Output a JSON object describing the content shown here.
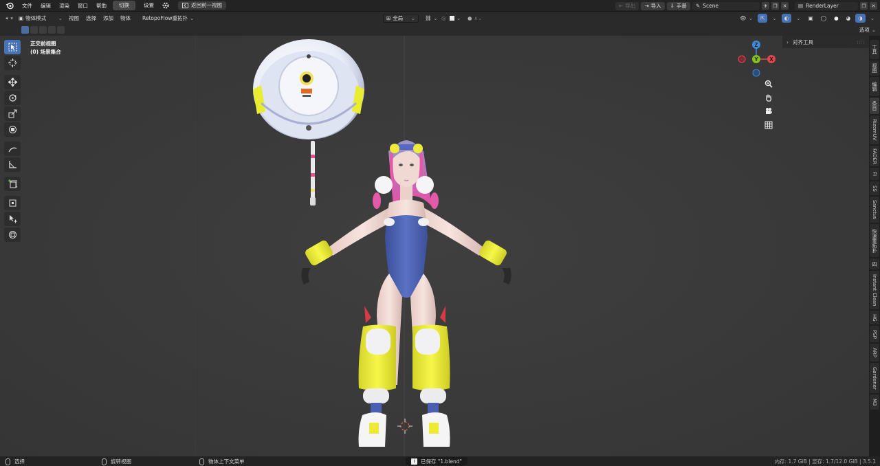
{
  "topbar": {
    "menus": [
      "文件",
      "编辑",
      "渲染",
      "窗口",
      "帮助"
    ],
    "workspace_tabs": [
      "切换",
      "设置"
    ],
    "back_button": "返回前一视图",
    "export_label": "导出",
    "import_label": "导入",
    "manual_label": "手册",
    "scene": "Scene",
    "render_layer": "RenderLayer"
  },
  "header": {
    "mode": "物体模式",
    "menus": [
      "视图",
      "选择",
      "添加",
      "物体"
    ],
    "addon_menu": "RetopoFlow重拓扑",
    "transform_orientation": "全局",
    "options": "选项"
  },
  "viewport": {
    "view_name": "正交前视图",
    "collection": "(0) 场景集合",
    "gizmo_axes": {
      "x": "X",
      "y": "Y",
      "z": "Z"
    }
  },
  "npanel": {
    "panel_title": "对齐工具"
  },
  "sidebar_tabs": [
    "工具",
    "视图",
    "编辑",
    "条目",
    "RizomUV",
    "FADER",
    "FI",
    "SS",
    "Sanctus",
    "快速重拓扑",
    "四",
    "Instant Clean",
    "HG",
    "PSP",
    "ARP",
    "Gardener",
    "M3"
  ],
  "statusbar": {
    "select": "选择",
    "rotate": "旋转视图",
    "context_menu": "物体上下文菜单",
    "saved_message": "已保存 \"1.blend\"",
    "stats": "内存: 1.7 GiB | 显存: 1.7/12.0 GiB | 3.5.1"
  },
  "colors": {
    "accent": "#4772b3",
    "axis_x": "#e2464d",
    "axis_y": "#84c11d",
    "axis_z": "#3d8bd8",
    "suit_blue": "#4d63b6",
    "accent_yellow": "#f2f239"
  }
}
